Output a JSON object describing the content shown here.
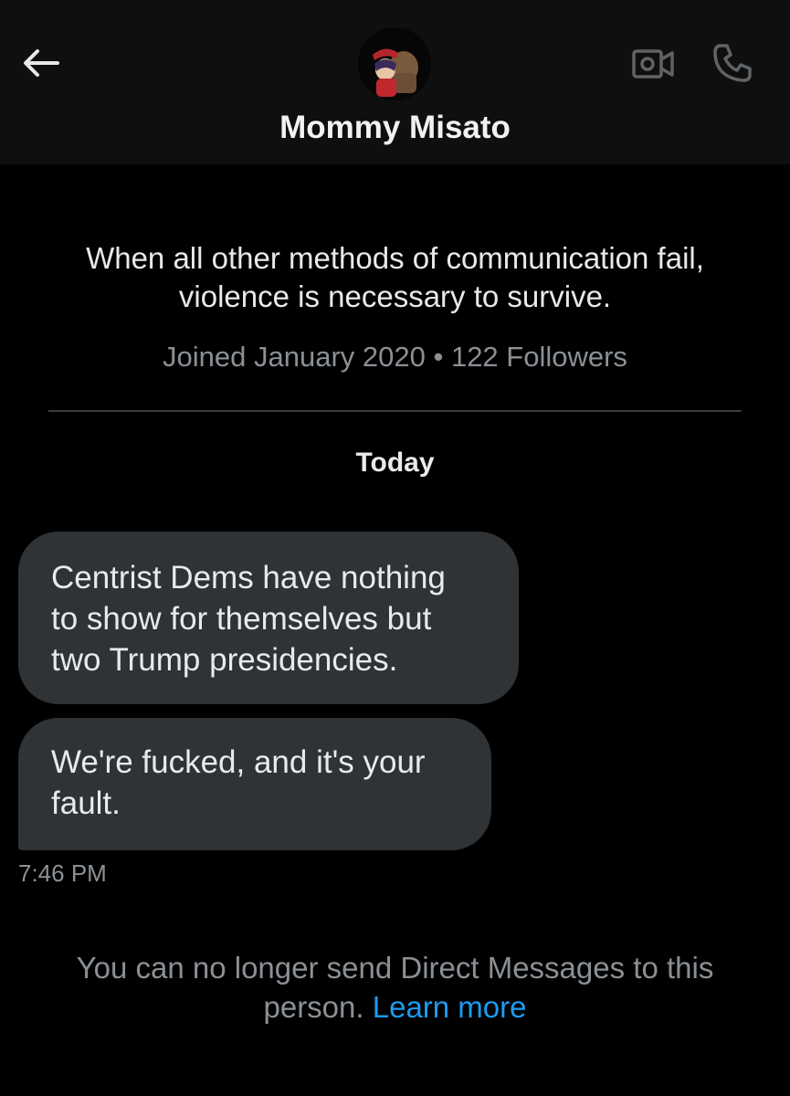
{
  "header": {
    "contact_name": "Mommy Misato",
    "icons": {
      "back": "arrow-left-icon",
      "video": "video-camera-icon",
      "call": "phone-icon"
    }
  },
  "profile": {
    "bio_line1": "When all other methods of communication fail,",
    "bio_line2": "violence is necessary to survive.",
    "meta": "Joined January 2020 • 122 Followers"
  },
  "conversation": {
    "date_label": "Today",
    "messages": [
      {
        "lines": [
          "Centrist Dems have nothing",
          "to show for themselves but",
          "two Trump presidencies."
        ]
      },
      {
        "lines": [
          "We're fucked, and it's your",
          "fault."
        ]
      }
    ],
    "timestamp": "7:46 PM"
  },
  "notice": {
    "text_line1": "You can no longer send Direct Messages to this",
    "text_line2": "person.",
    "link": "Learn more"
  },
  "colors": {
    "background": "#000000",
    "header": "#0f0f0f",
    "bubble": "#2f3336",
    "secondary_text": "#8b9095",
    "link": "#1d9bf0"
  }
}
